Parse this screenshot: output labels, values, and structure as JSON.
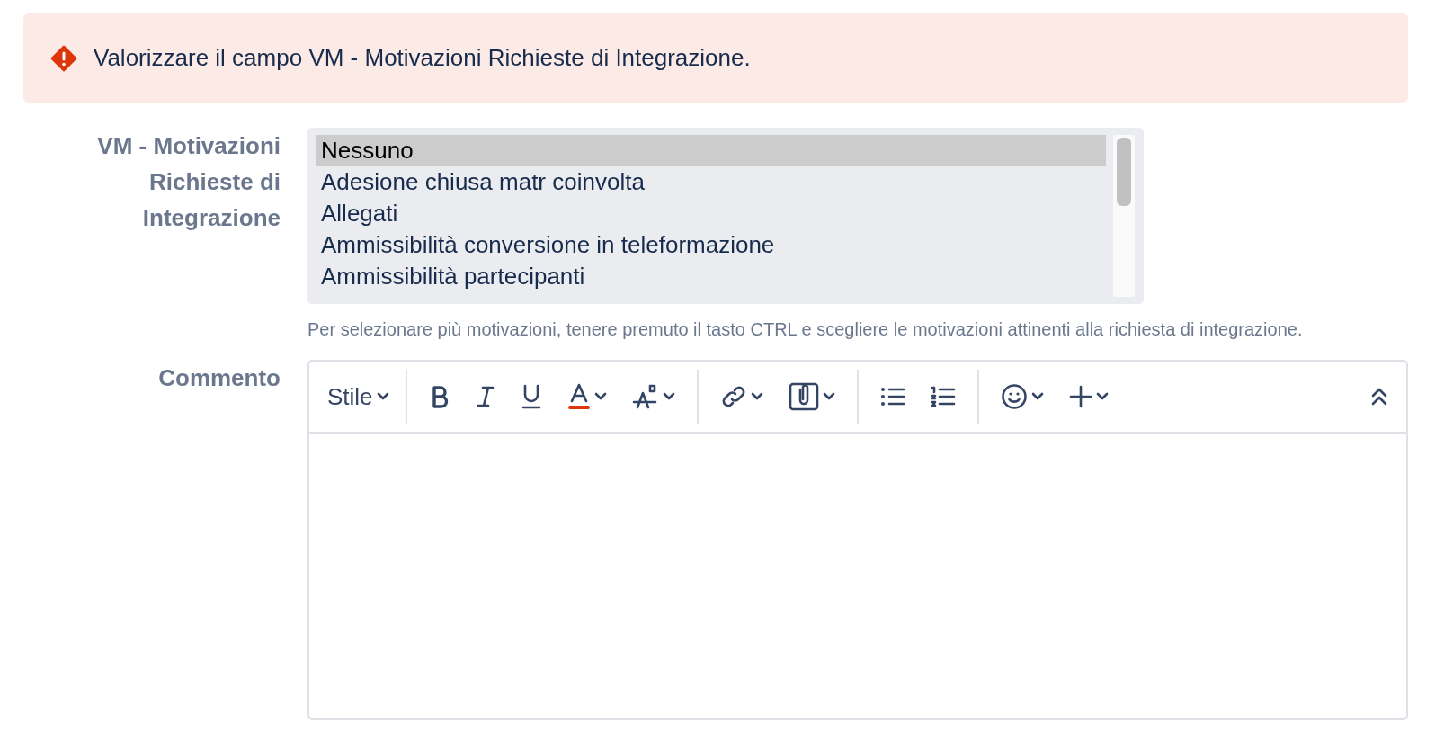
{
  "alert": {
    "message": "Valorizzare il campo VM - Motivazioni Richieste di Integrazione."
  },
  "motivations_field": {
    "label": "VM - Motivazioni Richieste di Integrazione",
    "options": [
      {
        "text": "Nessuno",
        "selected": true
      },
      {
        "text": "Adesione chiusa matr coinvolta",
        "selected": false
      },
      {
        "text": "Allegati",
        "selected": false
      },
      {
        "text": "Ammissibilità conversione in teleformazione",
        "selected": false
      },
      {
        "text": "Ammissibilità partecipanti",
        "selected": false
      }
    ],
    "help": "Per selezionare più motivazioni, tenere premuto il tasto CTRL e scegliere le motivazioni attinenti alla richiesta di integrazione."
  },
  "comment_field": {
    "label": "Commento",
    "toolbar": {
      "style_label": "Stile"
    }
  }
}
